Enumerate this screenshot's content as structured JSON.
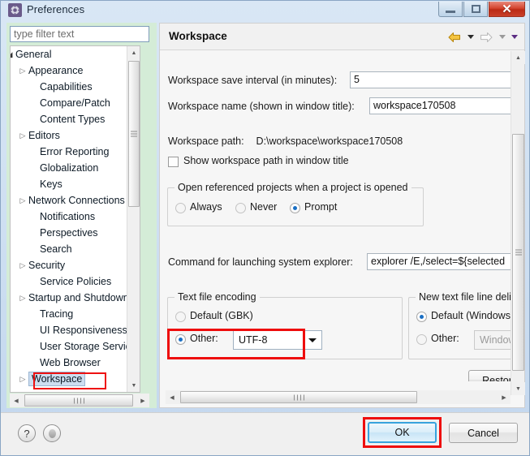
{
  "window": {
    "title": "Preferences",
    "icon": "gear-icon",
    "controls": {
      "minimize": "minimize-icon",
      "maximize": "maximize-icon",
      "close": "✕"
    }
  },
  "sidebar": {
    "filter": {
      "placeholder": "type filter text",
      "value": ""
    },
    "items": [
      {
        "label": "General",
        "indent": 6,
        "arrow": "open",
        "selected": false
      },
      {
        "label": "Appearance",
        "indent": 22,
        "arrow": "closed",
        "selected": false
      },
      {
        "label": "Capabilities",
        "indent": 36,
        "arrow": "none",
        "selected": false
      },
      {
        "label": "Compare/Patch",
        "indent": 36,
        "arrow": "none",
        "selected": false
      },
      {
        "label": "Content Types",
        "indent": 36,
        "arrow": "none",
        "selected": false
      },
      {
        "label": "Editors",
        "indent": 22,
        "arrow": "closed",
        "selected": false
      },
      {
        "label": "Error Reporting",
        "indent": 36,
        "arrow": "none",
        "selected": false
      },
      {
        "label": "Globalization",
        "indent": 36,
        "arrow": "none",
        "selected": false
      },
      {
        "label": "Keys",
        "indent": 36,
        "arrow": "none",
        "selected": false
      },
      {
        "label": "Network Connections",
        "indent": 22,
        "arrow": "closed",
        "selected": false
      },
      {
        "label": "Notifications",
        "indent": 36,
        "arrow": "none",
        "selected": false
      },
      {
        "label": "Perspectives",
        "indent": 36,
        "arrow": "none",
        "selected": false
      },
      {
        "label": "Search",
        "indent": 36,
        "arrow": "none",
        "selected": false
      },
      {
        "label": "Security",
        "indent": 22,
        "arrow": "closed",
        "selected": false
      },
      {
        "label": "Service Policies",
        "indent": 36,
        "arrow": "none",
        "selected": false
      },
      {
        "label": "Startup and Shutdown",
        "indent": 22,
        "arrow": "closed",
        "selected": false
      },
      {
        "label": "Tracing",
        "indent": 36,
        "arrow": "none",
        "selected": false
      },
      {
        "label": "UI Responsiveness Monitoring",
        "indent": 36,
        "arrow": "none",
        "selected": false
      },
      {
        "label": "User Storage Service",
        "indent": 36,
        "arrow": "none",
        "selected": false
      },
      {
        "label": "Web Browser",
        "indent": 36,
        "arrow": "none",
        "selected": false
      },
      {
        "label": "Workspace",
        "indent": 22,
        "arrow": "closed",
        "selected": true
      }
    ]
  },
  "content": {
    "title": "Workspace",
    "nav": {
      "back": "back-arrow-icon",
      "forward": "forward-arrow-icon",
      "menu": "view-menu-icon"
    },
    "save_interval": {
      "label": "Workspace save interval (in minutes):",
      "value": "5"
    },
    "workspace_name": {
      "label": "Workspace name (shown in window title):",
      "value": "workspace170508"
    },
    "workspace_path": {
      "label": "Workspace path:",
      "value": "D:\\workspace\\workspace170508"
    },
    "show_path_checkbox": {
      "label": "Show workspace path in window title",
      "checked": false
    },
    "open_referenced": {
      "legend": "Open referenced projects when a project is opened",
      "options": [
        {
          "label": "Always",
          "checked": false
        },
        {
          "label": "Never",
          "checked": false
        },
        {
          "label": "Prompt",
          "checked": true
        }
      ]
    },
    "explorer_command": {
      "label": "Command for launching system explorer:",
      "value": "explorer /E,/select=${selected"
    },
    "text_file_encoding": {
      "legend": "Text file encoding",
      "default_label": "Default (GBK)",
      "default_checked": false,
      "other_label": "Other:",
      "other_checked": true,
      "other_value": "UTF-8",
      "highlighted": true
    },
    "line_delimiter": {
      "legend": "New text file line delimiter",
      "default_label": "Default (Windows)",
      "default_checked": true,
      "other_label": "Other:",
      "other_checked": false,
      "other_value": "Windows"
    },
    "restore_button": "Restore"
  },
  "footer": {
    "help_icon": "?",
    "apply_icon": "apply-icon",
    "ok_label": "OK",
    "cancel_label": "Cancel",
    "ok_highlighted": true
  },
  "colors": {
    "highlight_red": "#ee0d0d",
    "ok_border_blue": "#38a3dd",
    "sidebar_green": "#d4ecd7",
    "selection_blue": "#cddef0",
    "back_arrow_yellow": "#e8a317"
  }
}
